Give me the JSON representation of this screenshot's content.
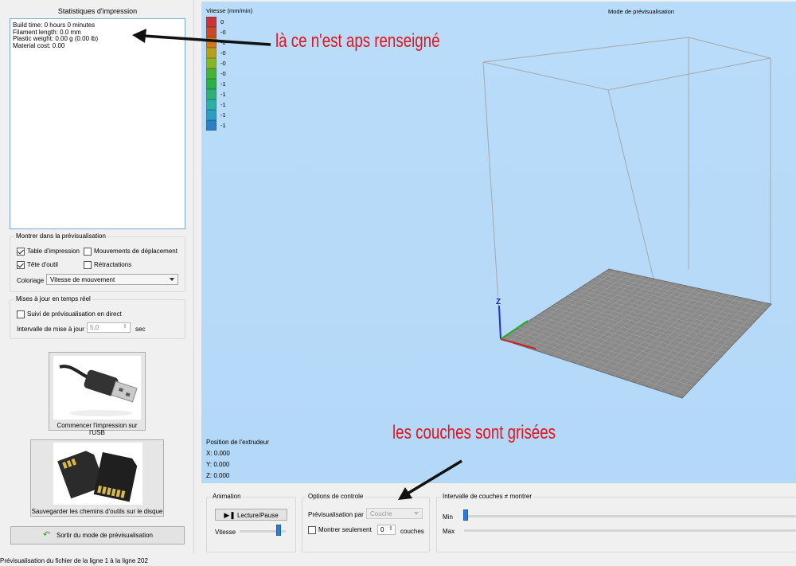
{
  "stats": {
    "title": "Statistiques d'impression",
    "lines": [
      "Build time: 0 hours 0 minutes",
      "Filament length: 0.0 mm",
      "Plastic weight: 0.00 g (0.00 lb)",
      "Material cost: 0.00"
    ]
  },
  "show_group": {
    "title": "Montrer dans la prévisualisation",
    "table_label": "Table d'impression",
    "moves_label": "Mouvements de déplacement",
    "tool_label": "Tête d'outil",
    "retract_label": "Rétractations",
    "color_label": "Coloriage",
    "color_value": "Vitesse de mouvement"
  },
  "realtime_group": {
    "title": "Mises à jour en temps réel",
    "follow_label": "Suivi de prévisualisation en direct",
    "interval_label": "Intervalle de mise à jour",
    "interval_value": "5,0",
    "interval_unit": "sec"
  },
  "usb_button": {
    "label": "Commencer l'impression sur l'USB"
  },
  "save_button": {
    "label": "Sauvegarder les chemins d'outils sur le disque"
  },
  "exit_button": {
    "label": "Sortir du mode de prévisualisation"
  },
  "viewport": {
    "speed_title": "Vitesse (mm/min)",
    "mode_title": "Mode de prévisualisation",
    "legend": [
      {
        "label": "0",
        "color": "#c8343c"
      },
      {
        "label": "-0",
        "color": "#c94a2a"
      },
      {
        "label": "-0",
        "color": "#cc7a1c"
      },
      {
        "label": "-0",
        "color": "#b7a01e"
      },
      {
        "label": "-0",
        "color": "#8ab32a"
      },
      {
        "label": "-0",
        "color": "#4ab238"
      },
      {
        "label": "-1",
        "color": "#2bb04a"
      },
      {
        "label": "-1",
        "color": "#2fb07a"
      },
      {
        "label": "-1",
        "color": "#2eb0a4"
      },
      {
        "label": "-1",
        "color": "#2d9ebf"
      },
      {
        "label": "-1",
        "color": "#2d7fc6"
      }
    ],
    "extruder_title": "Position de l'extrudeur",
    "x_label": "X: 0.000",
    "y_label": "Y: 0.000",
    "z_label": "Z: 0.000",
    "axis_z": "Z"
  },
  "animation": {
    "title": "Animation",
    "play_label": "Lecture/Pause",
    "speed_label": "Vitesse",
    "speed_level": 0.85
  },
  "control": {
    "title": "Options de controle",
    "preview_by_label": "Prévisualisation par",
    "preview_by_value": "Couche",
    "only_label": "Montrer seulement",
    "only_value": "0",
    "layers_unit": "couches"
  },
  "layer_range": {
    "title": "Intervalle de couches ≠ montrer",
    "min_label": "Min",
    "max_label": "Max"
  },
  "status": "Prévisualisation du fichier de la ligne 1 à la ligne 202",
  "annotations": {
    "top": "là ce n'est aps renseigné",
    "bottom": "les couches sont grisées"
  }
}
